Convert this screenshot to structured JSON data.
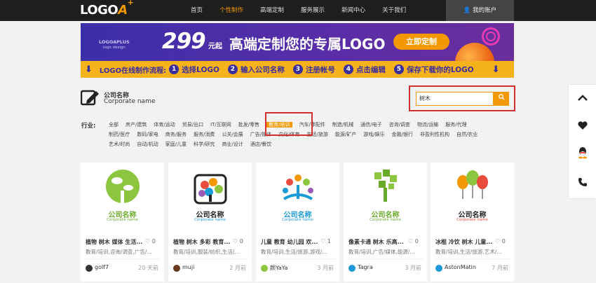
{
  "nav": {
    "logo_main": "LOGO",
    "logo_a": "A",
    "logo_plus": "+",
    "menu": [
      "首页",
      "个性制作",
      "高端定制",
      "服务展示",
      "新闻中心",
      "关于我们"
    ],
    "active_index": 1,
    "account": "👤 我的账户"
  },
  "banner": {
    "brand": "LOGOAPLUS",
    "brand_sub": "logo design",
    "price": "299",
    "price_unit": "元起",
    "slogan": "高端定制您的专属LOGO",
    "button": "立即定制"
  },
  "steps": {
    "lead": "LOGO在线制作流程:",
    "items": [
      {
        "n": "1",
        "t": "选择LOGO"
      },
      {
        "n": "2",
        "t": "输入公司名称"
      },
      {
        "n": "3",
        "t": "注册帐号"
      },
      {
        "n": "4",
        "t": "点击编辑"
      },
      {
        "n": "5",
        "t": "保存下载你的LOGO"
      }
    ]
  },
  "company": {
    "name_cn": "公司名称",
    "name_en": "Corporate name"
  },
  "search": {
    "value": "树木",
    "button_icon": "search-icon"
  },
  "industry": {
    "label": "行业:",
    "row1": [
      "全部",
      "房产/建筑",
      "体育/运动",
      "贸易/出口",
      "IT/互联网",
      "批发/零售",
      "教育/培训",
      "汽车/零配件",
      "制造/机械",
      "通信/电子",
      "咨询/调查",
      "物流/运输",
      "服务/代理"
    ],
    "row2": [
      "制药/医疗",
      "数码/家电",
      "商务/服务",
      "服务/消费",
      "公关/会展",
      "广告/媒体",
      "文化/体育",
      "生活/旅游",
      "能源/矿产",
      "游戏/娱乐",
      "金融/银行",
      "非盈利性机构",
      "自然/农业"
    ],
    "row3": [
      "艺术/时尚",
      "自动/机动",
      "家庭/儿童",
      "科学/研究",
      "商业/设计",
      "酒店/餐饮"
    ],
    "selected": "教育/培训"
  },
  "cards": [
    {
      "title": "植物 树木 媒体 生活...",
      "likes": "♡ 0",
      "tags": "教育/培训,咨询/调查,广告/...",
      "user": "golf7",
      "time": "20 天前",
      "name_cn": "公司名称",
      "name_en": "Corporate name",
      "color": "#6aaa2a"
    },
    {
      "title": "植物 树木 多彩 教育...",
      "likes": "♡ 0",
      "tags": "教育/培训,服装/纺织,生活/...",
      "user": "muji",
      "time": "2 月前",
      "name_cn": "公司名称",
      "name_en": "Corporate name",
      "color": "#e84c3d"
    },
    {
      "title": "儿童 教育 幼儿园 欢...",
      "likes": "♡ 1",
      "tags": "教育/培训,生活/旅游,游戏/...",
      "user": "颜YaYa",
      "time": "3 月前",
      "name_cn": "公司名称",
      "name_en": "Corporate name",
      "color": "#1a9ad6"
    },
    {
      "title": "像素卡通 树木 乐高...",
      "likes": "♡ 0",
      "tags": "教育/培训,广告/媒体,能源/...",
      "user": "Tagra",
      "time": "3 月前",
      "name_cn": "公司名称",
      "name_en": "Corporate name",
      "color": "#6aaa2a"
    },
    {
      "title": "冰棍 冷饮 树木 儿童...",
      "likes": "♡ 0",
      "tags": "教育/培训,生活/旅游,艺术/...",
      "user": "AstonMatin",
      "time": "7 月前",
      "name_cn": "公司名称",
      "name_en": "Corporate name",
      "color": "#e84c3d"
    }
  ],
  "side_icons": [
    "chevron-up-icon",
    "heart-icon",
    "qq-icon",
    "phone-icon"
  ]
}
